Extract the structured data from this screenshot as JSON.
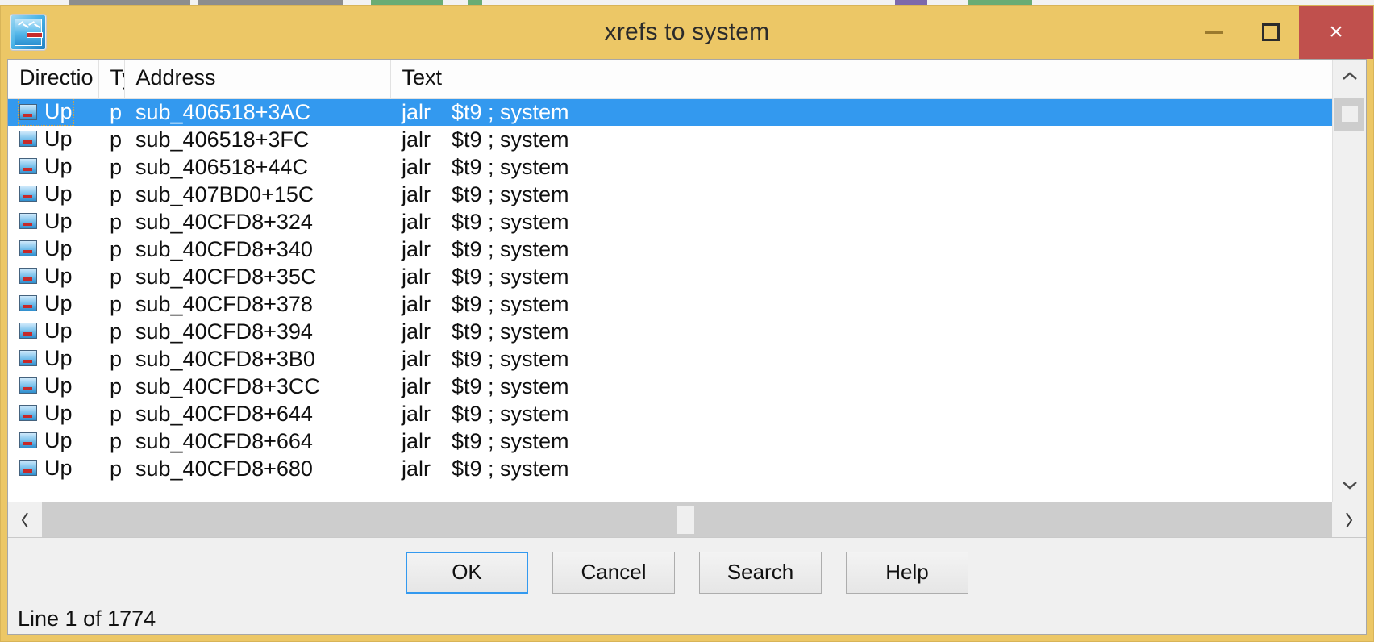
{
  "window": {
    "title": "xrefs to system",
    "app_icon": "ida-xrefs-icon",
    "titlebar_color": "#ecc766",
    "controls": {
      "minimize": "minimize-icon",
      "maximize": "maximize-icon",
      "close": "×",
      "close_color": "#c0504d"
    }
  },
  "list": {
    "columns": [
      {
        "key": "direction",
        "label": "Directio"
      },
      {
        "key": "type",
        "label": "Ty"
      },
      {
        "key": "address",
        "label": "Address"
      },
      {
        "key": "text",
        "label": "Text"
      }
    ],
    "selection_color": "#3399ef",
    "selected_index": 0,
    "rows": [
      {
        "direction": "Up",
        "type": "p",
        "address": "sub_406518+3AC",
        "op": "jalr",
        "operand": "$t9 ; system"
      },
      {
        "direction": "Up",
        "type": "p",
        "address": "sub_406518+3FC",
        "op": "jalr",
        "operand": "$t9 ; system"
      },
      {
        "direction": "Up",
        "type": "p",
        "address": "sub_406518+44C",
        "op": "jalr",
        "operand": "$t9 ; system"
      },
      {
        "direction": "Up",
        "type": "p",
        "address": "sub_407BD0+15C",
        "op": "jalr",
        "operand": "$t9 ; system"
      },
      {
        "direction": "Up",
        "type": "p",
        "address": "sub_40CFD8+324",
        "op": "jalr",
        "operand": "$t9 ; system"
      },
      {
        "direction": "Up",
        "type": "p",
        "address": "sub_40CFD8+340",
        "op": "jalr",
        "operand": "$t9 ; system"
      },
      {
        "direction": "Up",
        "type": "p",
        "address": "sub_40CFD8+35C",
        "op": "jalr",
        "operand": "$t9 ; system"
      },
      {
        "direction": "Up",
        "type": "p",
        "address": "sub_40CFD8+378",
        "op": "jalr",
        "operand": "$t9 ; system"
      },
      {
        "direction": "Up",
        "type": "p",
        "address": "sub_40CFD8+394",
        "op": "jalr",
        "operand": "$t9 ; system"
      },
      {
        "direction": "Up",
        "type": "p",
        "address": "sub_40CFD8+3B0",
        "op": "jalr",
        "operand": "$t9 ; system"
      },
      {
        "direction": "Up",
        "type": "p",
        "address": "sub_40CFD8+3CC",
        "op": "jalr",
        "operand": "$t9 ; system"
      },
      {
        "direction": "Up",
        "type": "p",
        "address": "sub_40CFD8+644",
        "op": "jalr",
        "operand": "$t9 ; system"
      },
      {
        "direction": "Up",
        "type": "p",
        "address": "sub_40CFD8+664",
        "op": "jalr",
        "operand": "$t9 ; system"
      },
      {
        "direction": "Up",
        "type": "p",
        "address": "sub_40CFD8+680",
        "op": "jalr",
        "operand": "$t9 ; system"
      }
    ]
  },
  "scrollbars": {
    "vertical": {
      "up": "chevron-up-icon",
      "down": "chevron-down-icon"
    },
    "horizontal": {
      "left": "chevron-left-icon",
      "right": "chevron-right-icon"
    }
  },
  "buttons": {
    "ok": "OK",
    "cancel": "Cancel",
    "search": "Search",
    "help": "Help",
    "focused": "ok"
  },
  "status": {
    "line_text": "Line 1 of 1774",
    "current_line": 1,
    "total_lines": 1774
  }
}
